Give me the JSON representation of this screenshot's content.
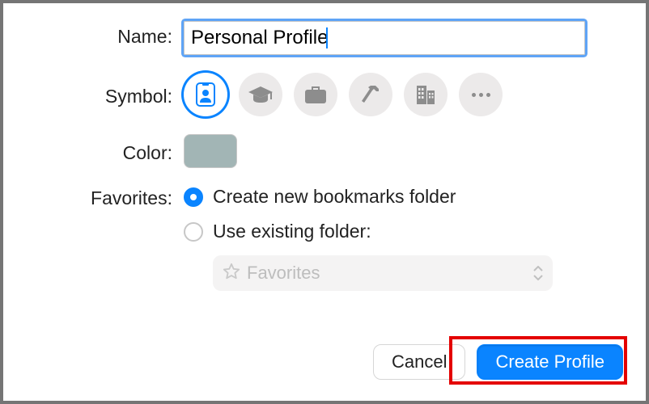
{
  "labels": {
    "name": "Name:",
    "symbol": "Symbol:",
    "color": "Color:",
    "favorites": "Favorites:"
  },
  "name_value": "Personal Profile",
  "symbols": {
    "selected_index": 0,
    "items": [
      "id-card-icon",
      "graduation-cap-icon",
      "briefcase-icon",
      "hammer-icon",
      "building-icon",
      "more-icon"
    ]
  },
  "color_hex": "#a2b5b5",
  "favorites": {
    "selected": "create_new",
    "create_new_label": "Create new bookmarks folder",
    "use_existing_label": "Use existing folder:",
    "picker": {
      "placeholder": "Favorites",
      "enabled": false
    }
  },
  "buttons": {
    "cancel": "Cancel",
    "create": "Create Profile"
  },
  "accent": "#0a84ff"
}
